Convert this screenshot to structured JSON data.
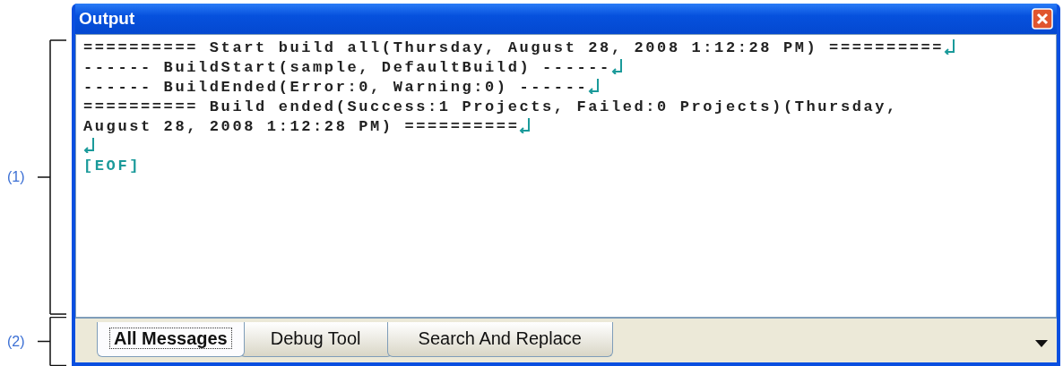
{
  "window": {
    "title": "Output"
  },
  "output_lines": [
    {
      "text": "========== Start build all(Thursday, August 28, 2008 1:12:28 PM) ==========",
      "eol": true
    },
    {
      "text": "------ BuildStart(sample, DefaultBuild) ------",
      "eol": true
    },
    {
      "text": "------ BuildEnded(Error:0, Warning:0) ------",
      "eol": true
    },
    {
      "text": "========== Build ended(Success:1 Projects, Failed:0 Projects)(Thursday,",
      "eol": false
    },
    {
      "text": "August 28, 2008 1:12:28 PM) ==========",
      "eol": true
    },
    {
      "eol": true
    },
    {
      "text": "[EOF]",
      "eol": false
    }
  ],
  "tabs": [
    {
      "label": "All Messages",
      "selected": true
    },
    {
      "label": "Debug Tool",
      "selected": false
    },
    {
      "label": "Search And Replace",
      "selected": false
    }
  ],
  "callouts": [
    {
      "label": "(1)"
    },
    {
      "label": "(2)"
    }
  ]
}
